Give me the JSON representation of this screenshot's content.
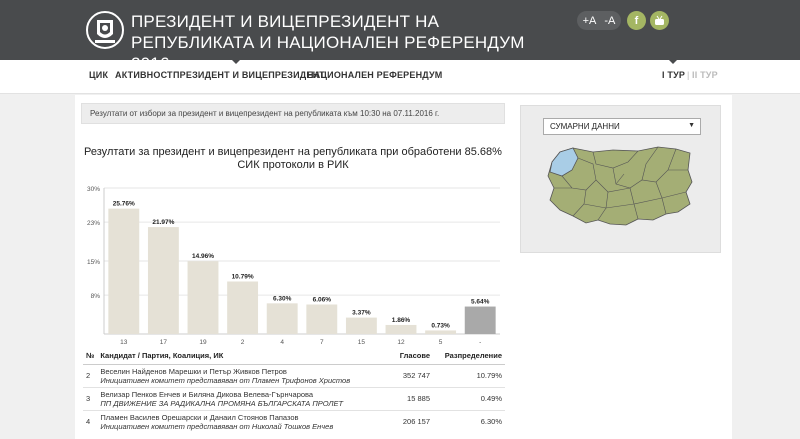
{
  "header": {
    "title": "ПРЕЗИДЕНТ И ВИЦЕПРЕЗИДЕНТ НА РЕПУБЛИКАТА И НАЦИОНАЛЕН РЕФЕРЕНДУМ 2016",
    "font_up": "+A",
    "font_down": "-A",
    "facebook_label": "f"
  },
  "nav": {
    "items": [
      "ЦИК",
      "АКТИВНОСТ",
      "ПРЕЗИДЕНТ И ВИЦЕПРЕЗИДЕНТ",
      "НАЦИОНАЛЕН РЕФЕРЕНДУМ"
    ],
    "round1": "I ТУР",
    "separator": "|",
    "round2": "II ТУР"
  },
  "notice": "Резултати от избори за президент и вицепрезидент на републиката към 10:30 на 07.11.2016 г.",
  "chart_title": "Резултати за президент и вицепрезидент на републиката при обработени 85.68% СИК протоколи в РИК",
  "chart_data": {
    "type": "bar",
    "categories": [
      "13",
      "17",
      "19",
      "2",
      "4",
      "7",
      "15",
      "12",
      "5",
      "-"
    ],
    "values": [
      25.76,
      21.97,
      14.96,
      10.79,
      6.3,
      6.06,
      3.37,
      1.86,
      0.73,
      5.64
    ],
    "value_labels": [
      "25.76%",
      "21.97%",
      "14.96%",
      "10.79%",
      "6.30%",
      "6.06%",
      "3.37%",
      "1.86%",
      "0.73%",
      "5.64%"
    ],
    "y_ticks": [
      "30%",
      "23%",
      "15%",
      "8%"
    ],
    "ylim": [
      0,
      30
    ],
    "colors": {
      "bar": "#e5e1d6",
      "other": "#a9a9a9"
    }
  },
  "table": {
    "headers": [
      "№",
      "Кандидат / Партия, Коалиция, ИК",
      "Гласове",
      "Разпределение"
    ],
    "rows": [
      {
        "no": "2",
        "candidate": "Веселин Найденов Марешки и Петър Живков Петров",
        "party": "Инициативен комитет представяван от Пламен Трифонов Христов",
        "votes": "352 747",
        "share": "10.79%"
      },
      {
        "no": "3",
        "candidate": "Велизар Пенков Енчев и Биляна Дикова Велева-Гърнчарова",
        "party": "ПП ДВИЖЕНИЕ ЗА РАДИКАЛНА ПРОМЯНА БЪЛГАРСКАТА ПРОЛЕТ",
        "votes": "15 885",
        "share": "0.49%"
      },
      {
        "no": "4",
        "candidate": "Пламен Василев Орешарски и Данаил Стоянов Папазов",
        "party": "Инициативен комитет представяван от Николай Тошков Енчев",
        "votes": "206 157",
        "share": "6.30%"
      }
    ]
  },
  "map_panel": {
    "select_value": "СУМАРНИ ДАННИ",
    "colors": {
      "region": "#a4ae75",
      "highlight": "#a9cde6",
      "border": "#555"
    }
  }
}
